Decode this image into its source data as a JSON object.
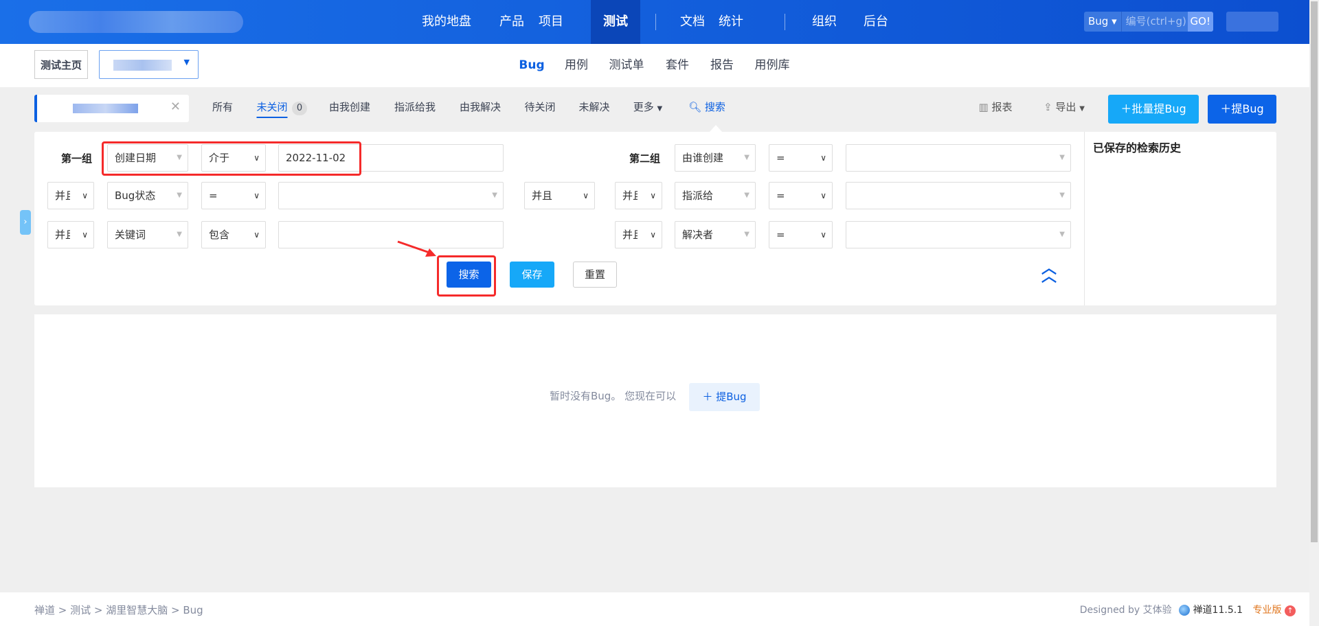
{
  "topnav": {
    "items": [
      "我的地盘",
      "产品",
      "项目",
      "测试",
      "文档",
      "统计",
      "组织",
      "后台"
    ],
    "active": "测试",
    "search": {
      "type": "Bug",
      "placeholder": "编号(ctrl+g)",
      "go": "GO!"
    }
  },
  "subnav": {
    "home": "测试主页",
    "tabs": [
      "Bug",
      "用例",
      "测试单",
      "套件",
      "报告",
      "用例库"
    ],
    "active": "Bug"
  },
  "toolbar": {
    "filters": [
      "所有",
      "未关闭",
      "由我创建",
      "指派给我",
      "由我解决",
      "待关闭",
      "未解决",
      "更多"
    ],
    "unclosed_count": "0",
    "search": "搜索",
    "report": "报表",
    "export": "导出",
    "batch_create": "批量提Bug",
    "create": "提Bug"
  },
  "search": {
    "group1": "第一组",
    "group2": "第二组",
    "group_and": "并且",
    "rows1": [
      {
        "and": "",
        "field": "创建日期",
        "op": "介于",
        "value": "2022-11-02"
      },
      {
        "and": "并且",
        "field": "Bug状态",
        "op": "=",
        "value": ""
      },
      {
        "and": "并且",
        "field": "关键词",
        "op": "包含",
        "value": ""
      }
    ],
    "rows2": [
      {
        "and": "",
        "field": "由谁创建",
        "op": "=",
        "value": ""
      },
      {
        "and": "并且",
        "field": "指派给",
        "op": "=",
        "value": ""
      },
      {
        "and": "并且",
        "field": "解决者",
        "op": "=",
        "value": ""
      }
    ],
    "search_btn": "搜索",
    "save_btn": "保存",
    "reset_btn": "重置",
    "history_title": "已保存的检索历史"
  },
  "empty": {
    "message": "暂时没有Bug。 您现在可以",
    "create": "提Bug"
  },
  "footer": {
    "breadcrumb": [
      "禅道",
      "测试",
      "湖里智慧大脑",
      "Bug"
    ],
    "designed_by": "Designed by 艾体验",
    "version": "禅道11.5.1",
    "edition": "专业版"
  }
}
